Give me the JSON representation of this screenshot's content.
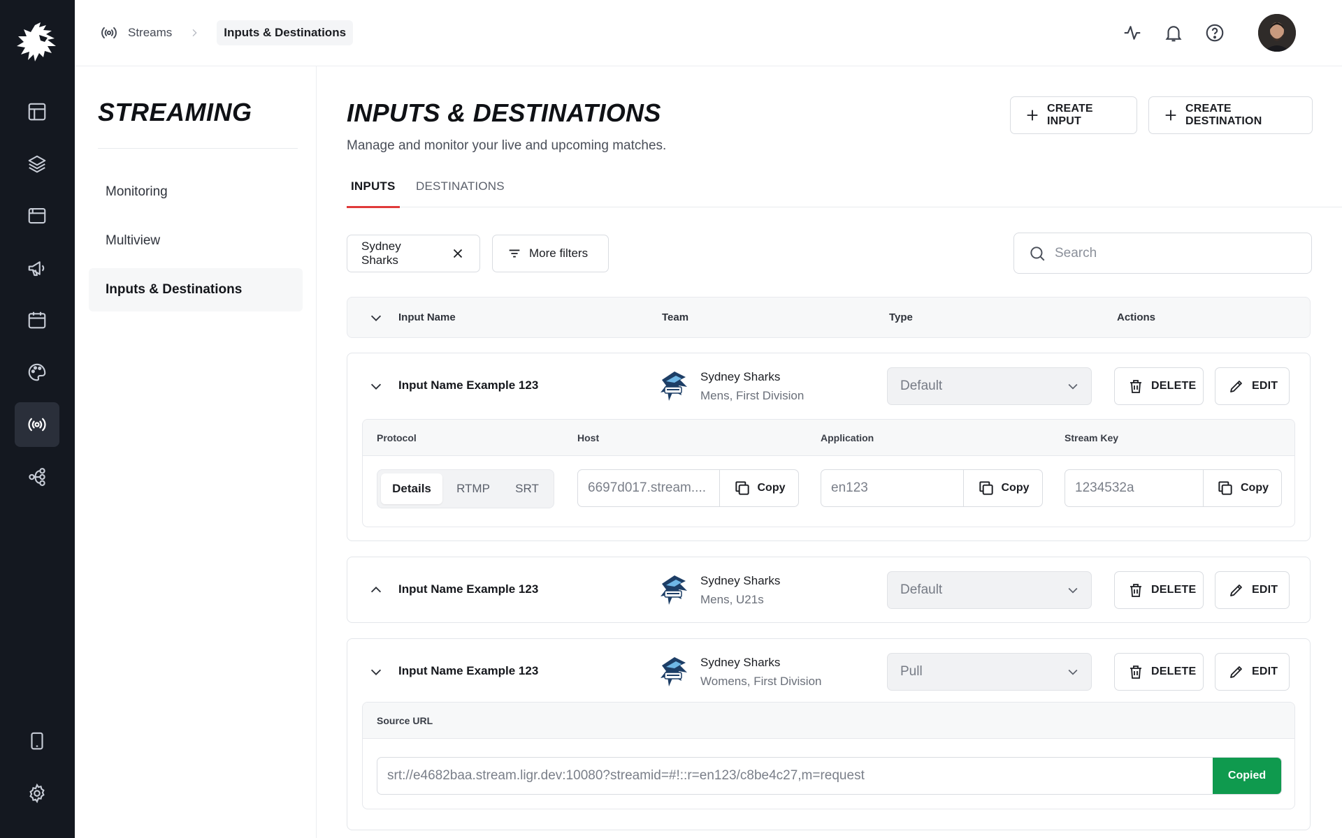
{
  "breadcrumb": {
    "root": "Streams",
    "current": "Inputs & Destinations"
  },
  "sidebar": {
    "title": "STREAMING",
    "items": [
      {
        "label": "Monitoring",
        "active": false
      },
      {
        "label": "Multiview",
        "active": false
      },
      {
        "label": "Inputs & Destinations",
        "active": true
      }
    ]
  },
  "main": {
    "title": "INPUTS & DESTINATIONS",
    "subtitle": "Manage and monitor your live and upcoming matches.",
    "create_input_label": "CREATE INPUT",
    "create_destination_label": "CREATE DESTINATION",
    "tabs": [
      {
        "label": "INPUTS",
        "active": true
      },
      {
        "label": "DESTINATIONS",
        "active": false
      }
    ],
    "filters": {
      "active_chip": "Sydney Sharks",
      "more_filters_label": "More filters"
    },
    "search": {
      "placeholder": "Search",
      "value": ""
    },
    "table": {
      "columns": [
        "Input Name",
        "Team",
        "Type",
        "Actions"
      ],
      "delete_label": "DELETE",
      "edit_label": "EDIT",
      "rows": [
        {
          "name": "Input Name Example 123",
          "team": "Sydney Sharks",
          "division": "Mens, First Division",
          "type": "Default",
          "expanded": true,
          "details": {
            "columns": [
              "Protocol",
              "Host",
              "Application",
              "Stream Key"
            ],
            "protocols": [
              "Details",
              "RTMP",
              "SRT"
            ],
            "selected_protocol": "Details",
            "host": "6697d017.stream....",
            "application": "en123",
            "stream_key": "1234532a",
            "copy_label": "Copy"
          }
        },
        {
          "name": "Input Name Example 123",
          "team": "Sydney Sharks",
          "division": "Mens, U21s",
          "type": "Default",
          "expanded": false
        },
        {
          "name": "Input Name Example 123",
          "team": "Sydney Sharks",
          "division": "Womens, First Division",
          "type": "Pull",
          "expanded": true,
          "source": {
            "label": "Source URL",
            "url": "srt://e4682baa.stream.ligr.dev:10080?streamid=#!::r=en123/c8be4c27,m=request",
            "copied_label": "Copied"
          }
        }
      ]
    }
  },
  "colors": {
    "accent": "#e03a3a",
    "success": "#0f9a4e",
    "rail": "#141820"
  },
  "icons": {
    "rail": [
      "lion-logo-icon",
      "layout-icon",
      "layers-icon",
      "browser-icon",
      "megaphone-icon",
      "calendar-icon",
      "palette-icon",
      "broadcast-icon",
      "workflow-icon",
      "tablet-icon",
      "gear-icon"
    ],
    "top": [
      "activity-icon",
      "bell-icon",
      "help-icon"
    ]
  }
}
